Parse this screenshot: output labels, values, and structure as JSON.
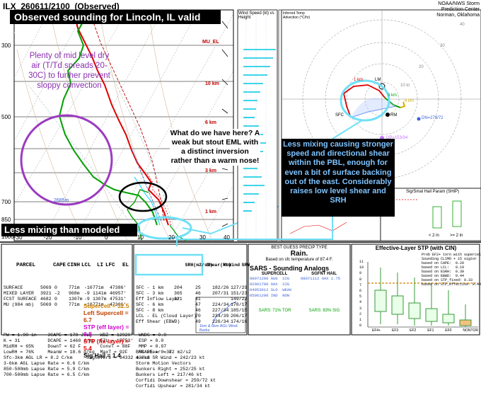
{
  "header": {
    "station": "ILX",
    "datetime": "260611/2100",
    "obs": "(Observed)"
  },
  "title": "Observed sounding for Lincoln, IL valid 4PM",
  "credit": [
    "NOAA/NWS Storm Prediction Center",
    "Norman, Oklahoma"
  ],
  "pressure_labels": [
    "300",
    "500",
    "700",
    "850",
    "1000"
  ],
  "height_labels": [
    "MU_EL",
    "2685m",
    "10 km",
    "6 km",
    "3 km",
    "1 km"
  ],
  "temp_ticks": [
    "-30",
    "-20",
    "-10",
    "0",
    "10",
    "20",
    "30",
    "40"
  ],
  "wind_panel": {
    "title": "Wind Speed (kt) vs Height",
    "t2": "Inferred Temp Advection (°C/hr)"
  },
  "annotations": {
    "purple": "Plenty of mid level dry air (T/Td spreads 20-30C) to further prevent sloppy convection",
    "black": "What do we have here? A weak but stout EML with a distinct inversion rather than a warm nose!",
    "blue": "Less mixing causing stronger speed and directional shear within the PBL, enough for even a bit of surface backing out of the east. Considerably raises low level shear and SRH",
    "less_mixing": "Less mixing than modeled"
  },
  "hodo": {
    "labels": [
      "SFC",
      "1 km",
      "3 km",
      "6 km",
      "LM",
      "RM",
      "DN=279/72",
      "UP=153/34"
    ],
    "rings": [
      "10 kt",
      "20",
      "30",
      "40"
    ]
  },
  "parcel_table": {
    "headers": [
      "PARCEL",
      "CAPE",
      "CINH",
      "LCL",
      "LI",
      "LFC",
      "EL"
    ],
    "rows": [
      [
        "SURFACE",
        "5069",
        "0",
        "771m",
        "-10",
        "771m",
        "47386'"
      ],
      [
        "MIXED LAYER",
        "3921",
        "-2",
        "968m",
        "-9",
        "1141m",
        "46957'"
      ],
      [
        "FCST SURFACE",
        "4682",
        "0",
        "1307m",
        "-9",
        "1307m",
        "47531'"
      ],
      [
        "MU (984 mb)",
        "5069",
        "0",
        "771m",
        "-10",
        "771m",
        "47386'"
      ]
    ],
    "misc": [
      "PW = 1.90 in    3CAPE = 178 J/kg   WBZ = 12920'  WNDG = 0.0",
      "K = 31          DCAPE = 1460 J/kg  FZL = 15753'  ESP = 0.0",
      "MidRH = 65%     DownT = 62 F       ConvT = 88F   MMP = 0.97",
      "LowRH = 76%     MeanW = 18.6 g/kg  MaxT = 92F    NCAPE = 0.37",
      "Sfc-3km AGL LR = 8.2 C/km     SigSevere = 94332 m3/s3",
      "3-6km AGL Lapse Rate = 6.6 C/km",
      "850-500mb Lapse Rate = 5.9 C/km",
      "700-500mb Lapse Rate = 6.5 C/km"
    ],
    "supercell": [
      "Supercell = 32.5",
      "Left Supercell = 6.7",
      "STP (eff layer) = 6.8",
      "STP (fix layer) = 5.4",
      "Sig Hail = 1.4"
    ]
  },
  "shear_table": {
    "headers": [
      "SRH(m2/s2)",
      "Shear(kt)",
      "MnWind",
      "SRW"
    ],
    "rows": [
      [
        "SFC - 1 km",
        "204",
        "25",
        "182/26",
        "127/29"
      ],
      [
        "SFC - 3 km",
        "365",
        "46",
        "207/31",
        "151/23"
      ],
      [
        "Eff Inflow Layer",
        "321",
        "41",
        "",
        "149/22"
      ],
      [
        "SFC - 6 km",
        "",
        "47",
        "224/34",
        "178/17"
      ],
      [
        "SFC - 8 km",
        "",
        "46",
        "227/34",
        "185/15"
      ],
      [
        "LCL - EL (Cloud Layer)",
        "",
        "70",
        "234/39",
        "206/17"
      ],
      [
        "Eff Shear (EBWD)",
        "",
        "49",
        "226/34",
        "174/16"
      ]
    ],
    "misc": [
      "BRN Shear = 82 m2/s2",
      "4-6km SR Wind = 242/23 kt",
      "Storm Motion Vectors",
      "Bunkers Right = 252/25 kt",
      "Bunkers Left = 217/46 kt",
      "Corfidi Downshear = 259/72 kt",
      "Corfidi Upshear = 281/34 kt"
    ]
  },
  "precip": {
    "title": "BEST GUESS PRECIP TYPE",
    "type": "Rain.",
    "note": "Based on sfc temperature of 87.4 F."
  },
  "sars": {
    "title": "SARS - Sounding Analogs",
    "headers": [
      "SUPERCELL",
      "SGFNT HAIL"
    ],
    "sc_lines": [
      "98071200 AUG  SIG",
      "92061700 OAX  SIG",
      "04053012 SLO  WEAK",
      "05061200 IND  NON"
    ],
    "hail_lines": [
      "98071112 OAX 1.75",
      "",
      "",
      ""
    ],
    "footer": [
      "SARS: 71% TOR",
      "SARS: 83% SIG"
    ]
  },
  "stp": {
    "title": "Effective-Layer STP (with CIN)",
    "legend": [
      "Prob EF2+ torn with supercell",
      "Sounding CLIMO + 15 sigtor",
      "based on CAPE:  0.20",
      "based on LCL:   0.19",
      "based on ESRH:  0.39",
      "based on EBWD:  0.44",
      "based on STP_fixed: 0.33",
      "based on STP_effective: 0.44"
    ],
    "yaxis": [
      "11",
      "10",
      "9",
      "8",
      "7",
      "6",
      "5",
      "4",
      "3",
      "2",
      "1",
      "0"
    ],
    "xaxis": [
      "EF4+",
      "EF3",
      "EF2",
      "EF1",
      "EF0",
      "NONTOR"
    ]
  },
  "ship": {
    "title": "Sig/Smal Hail Param (SHIP)",
    "xaxis": [
      "< 2 in",
      ">= 2 in"
    ]
  },
  "storm_slinky": {
    "label": "1km & 6km AGL Wind Barbs"
  },
  "chart_data": {
    "type": "line",
    "title": "",
    "series": [
      {
        "name": "",
        "values": []
      }
    ]
  }
}
